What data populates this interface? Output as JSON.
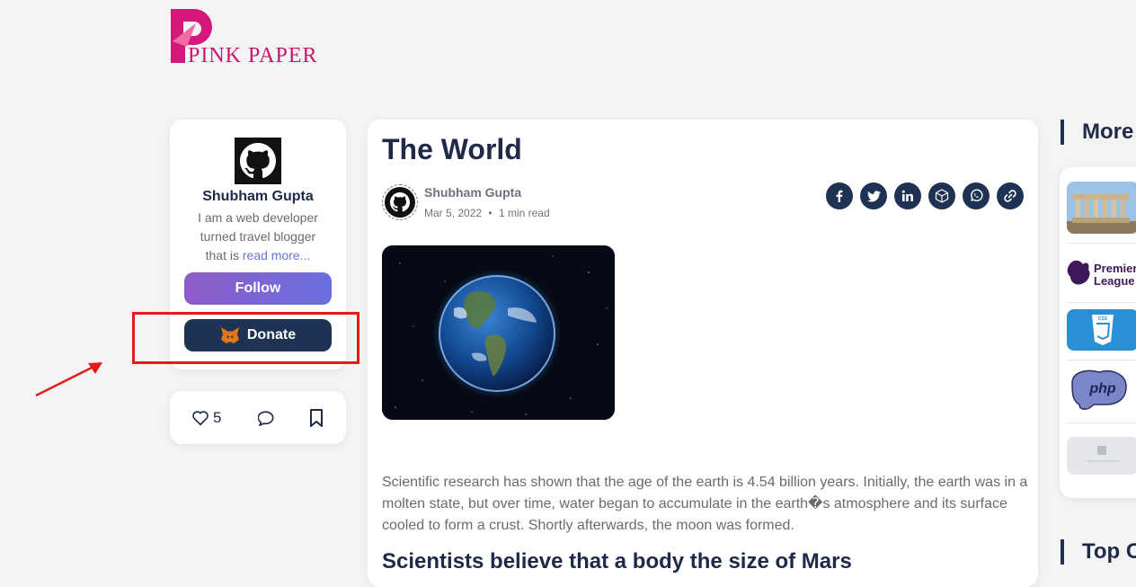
{
  "brand": {
    "name": "PINK PAPER",
    "logo_letter": "P",
    "color": "#c8176f"
  },
  "author_card": {
    "name": "Shubham Gupta",
    "bio_lines": [
      "I am a web developer",
      "turned travel blogger"
    ],
    "bio_prefix": "that is ",
    "read_more": "read more...",
    "follow_label": "Follow",
    "donate_label": "Donate",
    "donate_icon": "metamask-fox-icon"
  },
  "reactions": {
    "likes": "5",
    "like_icon": "heart-icon",
    "comment_icon": "comment-icon",
    "bookmark_icon": "bookmark-icon"
  },
  "article": {
    "title": "The World",
    "author": "Shubham Gupta",
    "date": "Mar 5, 2022",
    "read_time": "1 min read",
    "share_icons": [
      "facebook-icon",
      "twitter-icon",
      "linkedin-icon",
      "hashnode-cube-icon",
      "whatsapp-icon",
      "link-icon"
    ],
    "body": "Scientific research has shown that the age of the earth is 4.54 billion years. Initially, the earth was in a molten state, but over time, water began to accumulate in the earth�s atmosphere and its surface cooled to form a crust. Shortly afterwards, the moon was formed.",
    "subheading": "Scientists believe that a body the size of Mars"
  },
  "sidebar": {
    "more_title": "More",
    "top_title": "Top C",
    "items": [
      "Acropolis",
      "Premier League",
      "CSS",
      "php",
      "placeholder"
    ],
    "premier_line1": "Premier",
    "premier_line2": "League",
    "css_label": "CSS",
    "php_label": "php"
  },
  "annotation": {
    "color": "#e41b1b"
  }
}
